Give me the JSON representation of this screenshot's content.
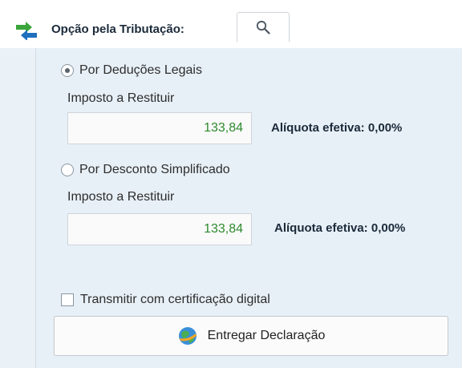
{
  "header": {
    "title": "Opção pela Tributação:",
    "search_icon": "search-icon",
    "arrows_icon": "swap-arrows-icon"
  },
  "option_legal": {
    "label": "Por Deduções Legais",
    "selected": true,
    "field_label": "Imposto a Restituir",
    "value": "133,84",
    "aliquota": "Alíquota efetiva: 0,00%"
  },
  "option_simplified": {
    "label": "Por Desconto Simplificado",
    "selected": false,
    "field_label": "Imposto a Restituir",
    "value": "133,84",
    "aliquota": "Alíquota efetiva: 0,00%"
  },
  "certificate": {
    "label": "Transmitir com certificação digital",
    "checked": false
  },
  "submit": {
    "label": "Entregar Declaração",
    "icon": "globe-icon"
  },
  "colors": {
    "value_green": "#2f8a2f",
    "panel_bg": "#e8f0f7",
    "title_text": "#1b2a3a"
  }
}
